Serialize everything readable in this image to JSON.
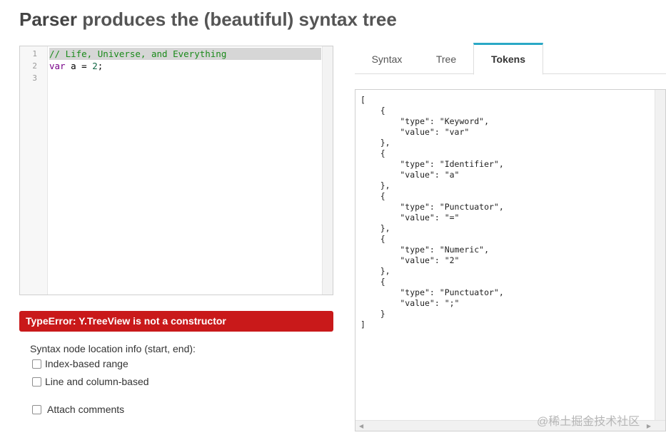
{
  "header": {
    "title_bold": "Parser",
    "title_rest": " produces the (beautiful) syntax tree"
  },
  "editor": {
    "line_numbers": [
      "1",
      "2",
      "3"
    ],
    "line1": "// Life, Universe, and Everything",
    "line2": {
      "keyword": "var",
      "middle": " a = ",
      "number": "2",
      "end": ";"
    }
  },
  "error": {
    "message": "TypeError: Y.TreeView is not a constructor"
  },
  "options": {
    "label": "Syntax node location info (start, end):",
    "index_range": "Index-based range",
    "line_column": "Line and column-based",
    "attach_comments": "Attach comments"
  },
  "tabs": [
    {
      "label": "Syntax"
    },
    {
      "label": "Tree"
    },
    {
      "label": "Tokens"
    }
  ],
  "output": {
    "text": "[\n    {\n        \"type\": \"Keyword\",\n        \"value\": \"var\"\n    },\n    {\n        \"type\": \"Identifier\",\n        \"value\": \"a\"\n    },\n    {\n        \"type\": \"Punctuator\",\n        \"value\": \"=\"\n    },\n    {\n        \"type\": \"Numeric\",\n        \"value\": \"2\"\n    },\n    {\n        \"type\": \"Punctuator\",\n        \"value\": \";\"\n    }\n]"
  },
  "scroll_arrows": {
    "left": "◀",
    "right": "▶"
  },
  "watermark": "@稀土掘金技术社区",
  "colors": {
    "error_bg": "#c9191a",
    "tab_accent": "#2aa8c6",
    "comment": "#1a8a1a",
    "keyword": "#770088",
    "number": "#116644"
  }
}
